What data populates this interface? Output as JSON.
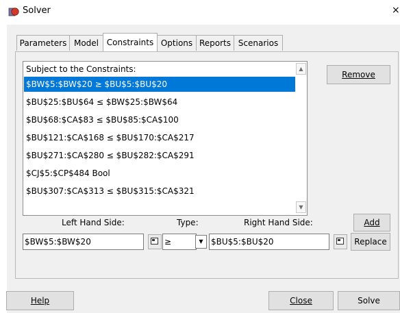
{
  "window": {
    "title": "Solver",
    "close_glyph": "×"
  },
  "tabs": [
    {
      "label": "Parameters"
    },
    {
      "label": "Model"
    },
    {
      "label": "Constraints"
    },
    {
      "label": "Options"
    },
    {
      "label": "Reports"
    },
    {
      "label": "Scenarios"
    }
  ],
  "active_tab": "Constraints",
  "constraints": {
    "header": "Subject to the Constraints:",
    "items": [
      "$BW$5:$BW$20 ≥ $BU$5:$BU$20",
      "$BU$25:$BU$64 ≤ $BW$25:$BW$64",
      "$BU$68:$CA$83 ≤ $BU$85:$CA$100",
      "$BU$121:$CA$168 ≤ $BU$170:$CA$217",
      "$BU$271:$CA$280 ≤ $BU$282:$CA$291",
      "$CJ$5:$CP$484 Bool",
      "$BU$307:$CA$313 ≤ $BU$315:$CA$321"
    ],
    "selected_index": 0,
    "remove_label": "Remove"
  },
  "editor": {
    "lhs_label": "Left Hand Side:",
    "type_label": "Type:",
    "rhs_label": "Right Hand Side:",
    "lhs_value": "$BW$5:$BW$20",
    "type_value": "≥",
    "rhs_value": "$BU$5:$BU$20",
    "add_label": "Add",
    "replace_label": "Replace"
  },
  "footer": {
    "help_label": "Help",
    "close_label": "Close",
    "solve_label": "Solve"
  },
  "colors": {
    "selection": "#0078d7",
    "dialog_bg": "#f0f0f0",
    "icon_red": "#d23b2c"
  },
  "icons": {
    "app": "solver-app-icon",
    "scroll_up": "scroll-up-arrow-icon",
    "scroll_down": "scroll-down-arrow-icon",
    "range_select": "range-select-icon",
    "dropdown": "chevron-down-icon"
  }
}
